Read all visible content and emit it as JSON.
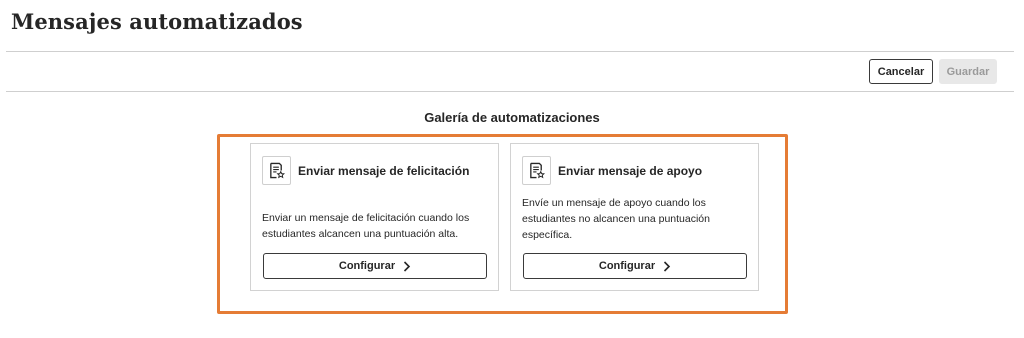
{
  "header": {
    "title": "Mensajes automatizados"
  },
  "toolbar": {
    "cancel_label": "Cancelar",
    "save_label": "Guardar"
  },
  "gallery": {
    "title": "Galería de automatizaciones",
    "highlight_color": "#e57c35",
    "cards": [
      {
        "icon": "document-star-icon",
        "title": "Enviar mensaje de felicitación",
        "description": "Enviar un mensaje de felicitación cuando los estudiantes alcancen una puntuación alta.",
        "button_label": "Configurar",
        "button_icon": "chevron-right-icon"
      },
      {
        "icon": "document-star-icon",
        "title": "Enviar mensaje de apoyo",
        "description": "Envíe un mensaje de apoyo cuando los estudiantes no alcancen una puntuación específica.",
        "button_label": "Configurar",
        "button_icon": "chevron-right-icon"
      }
    ]
  }
}
